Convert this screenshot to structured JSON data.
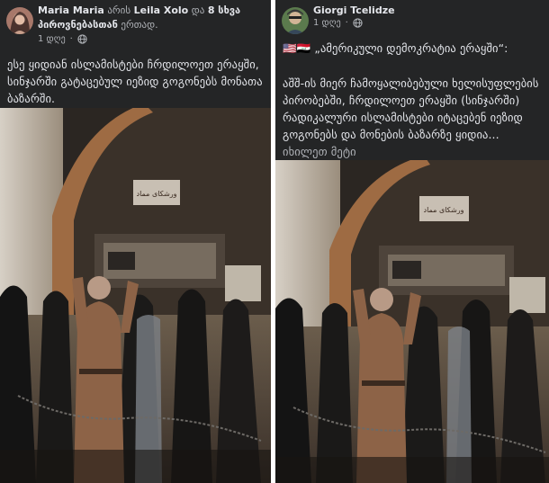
{
  "left_post": {
    "author": "Maria Maria",
    "connector": "არის",
    "tagged": "Leila Xolo",
    "and_word": "და",
    "others": "8 სხვა პიროვნებასთან",
    "tail": "ერთად.",
    "time": "1 დღე",
    "caption": "ესე ყიდიან ისლამისტები ჩრდილოეთ ერაყში, სინჯარში გატაცებულ იეზიდ გოგონებს მონათა ბაზარში.",
    "media_sign": "ورشكاى مماد"
  },
  "right_post": {
    "author": "Giorgi Tcelidze",
    "time": "1 დღე",
    "flags": "🇺🇸🇮🇶",
    "title": "„ამერიკული დემოკრატია ერაყში“:",
    "caption": "აშშ-ის მიერ ჩამოყალიბებული ხელისუფლების პირობებში, ჩრდილოეთ ერაყში (სინჯარში) რადიკალური ისლამისტები იტაცებენ იეზიდ გოგონებს და მონების ბაზარზე ყიდია...",
    "see_more": "იხილეთ მეტი",
    "media_sign": "ورشكاى مماد"
  },
  "colors": {
    "post_bg": "#242526",
    "text": "#e4e6eb",
    "muted": "#b0b3b8"
  }
}
